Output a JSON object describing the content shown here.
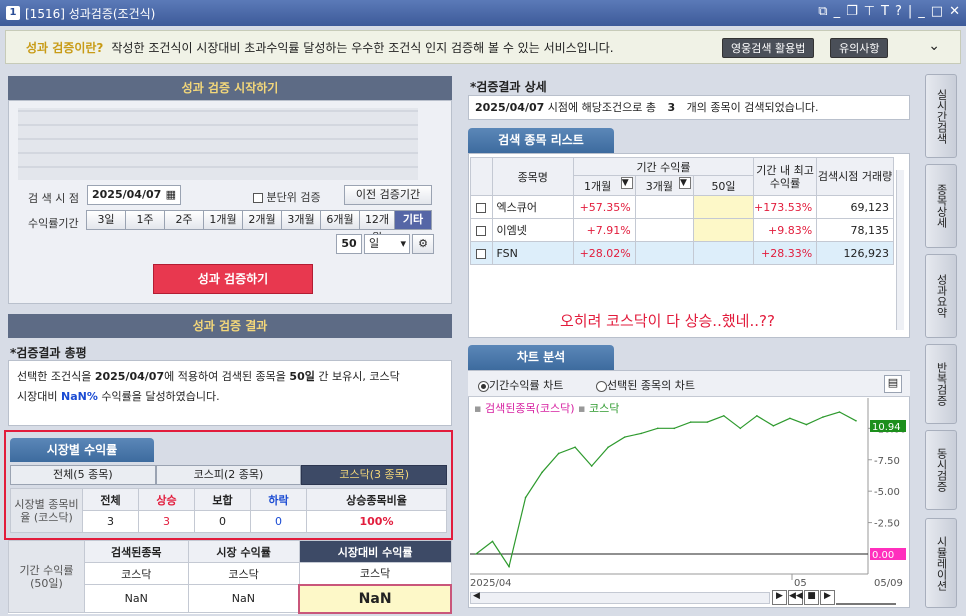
{
  "window": {
    "title": "[1516] 성과검증(조건식)",
    "icon_label": "1"
  },
  "info": {
    "question": "성과 검증이란?",
    "description": "작성한 조건식이 시장대비 초과수익률 달성하는 우수한 조건식 인지 검증해 볼 수 있는 서비스입니다.",
    "btn_guide": "영웅검색 활용법",
    "btn_notice": "유의사항"
  },
  "start": {
    "header": "성과 검증 시작하기",
    "search_date_label": "검 색 시 점",
    "search_date": "2025/04/07",
    "minute_check_label": "분단위 검증",
    "prev_btn": "이전 검증기간",
    "period_label": "수익률기간",
    "periods": [
      "3일",
      "1주",
      "2주",
      "1개월",
      "2개월",
      "3개월",
      "6개월",
      "12개월",
      "기타"
    ],
    "custom_value": "50",
    "custom_unit": "일",
    "run_btn": "성과 검증하기"
  },
  "result": {
    "header": "성과 검증 결과",
    "summary_title": "*검증결과 총평",
    "summary_p1": "선택한 조건식을",
    "summary_date": "2025/04/07",
    "summary_p2": "에 적용하여 검색된 종목을",
    "summary_days": "50일",
    "summary_p3": "간 보유시, 코스닥",
    "summary_p4": "시장대비",
    "summary_rate": "NaN%",
    "summary_p5": "수익률을 달성하였습니다.",
    "market_tab": "시장별 수익률",
    "market_tabs": [
      "전체(5 종목)",
      "코스피(2 종목)",
      "코스닥(3 종목)"
    ],
    "market_row_label": "시장별 종목비율 (코스닥)",
    "market_cols": [
      "전체",
      "상승",
      "보합",
      "하락",
      "상승종목비율"
    ],
    "market_vals": [
      "3",
      "3",
      "0",
      "0",
      "100%"
    ],
    "period_label": "기간 수익률 (50일)",
    "period_cols": [
      "검색된종목",
      "시장 수익률",
      "시장대비 수익률"
    ],
    "period_sub": [
      "코스닥",
      "코스닥",
      "코스닥"
    ],
    "period_vals": [
      "NaN",
      "NaN",
      "NaN"
    ]
  },
  "detail": {
    "title": "*검증결과 상세",
    "date": "2025/04/07",
    "p1": "시점에 해당조건으로 총",
    "count": "3",
    "p2": "개의 종목이 검색되었습니다.",
    "list_tab": "검색 종목 리스트",
    "col_name": "종목명",
    "col_period": "기간 수익률",
    "sub_cols": [
      "1개월",
      "3개월",
      "50일"
    ],
    "col_max": "기간 내 최고수익률",
    "col_vol": "검색시점 거래량",
    "rows": [
      {
        "name": "엑스큐어",
        "m1": "+57.35%",
        "max": "+173.53%",
        "vol": "69,123"
      },
      {
        "name": "이엠넷",
        "m1": "+7.91%",
        "max": "+9.83%",
        "vol": "78,135"
      },
      {
        "name": "FSN",
        "m1": "+28.02%",
        "max": "+28.33%",
        "vol": "126,923"
      }
    ],
    "overlay": "오히려 코스닥이 다 상승..했네..??"
  },
  "chart": {
    "tab": "차트 분석",
    "radio1": "기간수익률 차트",
    "radio2": "선택된 종목의 차트",
    "legend1": "검색된종목(코스닥)",
    "legend2": "코스닥",
    "last_label": "10.94",
    "zero_label": "0.00",
    "x_start": "2025/04",
    "x_mid": "05",
    "x_end": "05/09"
  },
  "chart_data": {
    "type": "line",
    "yticks": [
      "10.00",
      "7.50",
      "5.00",
      "2.50"
    ],
    "ylim": [
      0,
      11.3
    ],
    "series": [
      {
        "name": "코스닥",
        "color": "#2e9a2e",
        "values": [
          0.0,
          1.0,
          -1.0,
          4.5,
          6.5,
          8.0,
          8.5,
          7.0,
          8.5,
          9.3,
          9.6,
          10.0,
          10.0,
          10.5,
          10.5,
          11.0,
          10.0,
          11.0,
          10.2,
          10.8,
          10.3,
          10.9,
          11.3,
          10.6
        ]
      }
    ]
  },
  "side_tabs": [
    "실시간검색",
    "종목상세",
    "성과요약",
    "반복검증",
    "동시검증",
    "시뮬레이션"
  ]
}
